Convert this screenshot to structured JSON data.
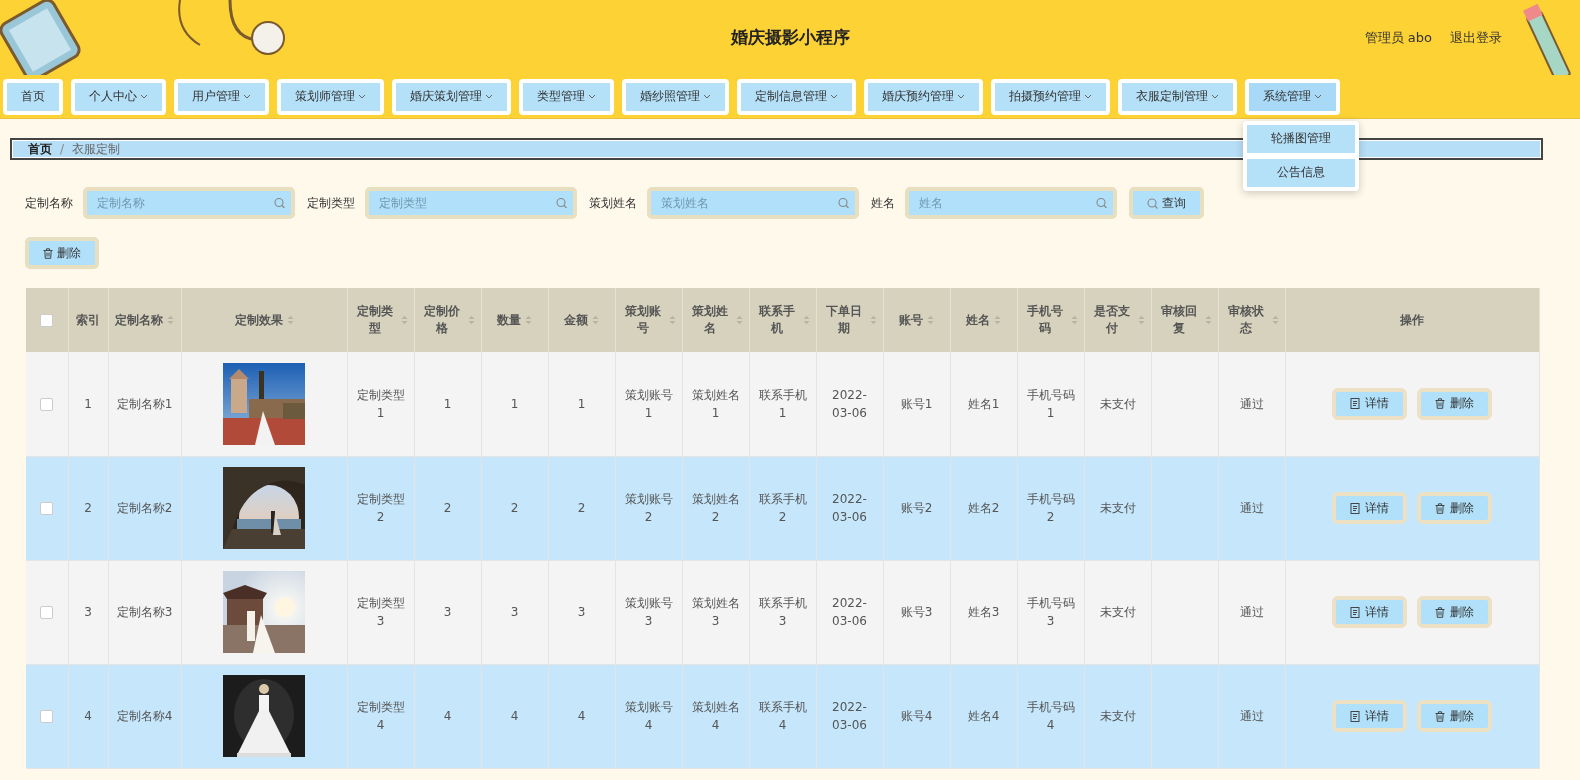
{
  "header": {
    "title": "婚庆摄影小程序",
    "user": "管理员 abo",
    "logout": "退出登录"
  },
  "nav": [
    {
      "label": "首页",
      "has_menu": false,
      "open": false
    },
    {
      "label": "个人中心",
      "has_menu": true,
      "open": false
    },
    {
      "label": "用户管理",
      "has_menu": true,
      "open": false
    },
    {
      "label": "策划师管理",
      "has_menu": true,
      "open": false
    },
    {
      "label": "婚庆策划管理",
      "has_menu": true,
      "open": false
    },
    {
      "label": "类型管理",
      "has_menu": true,
      "open": false
    },
    {
      "label": "婚纱照管理",
      "has_menu": true,
      "open": false
    },
    {
      "label": "定制信息管理",
      "has_menu": true,
      "open": false
    },
    {
      "label": "婚庆预约管理",
      "has_menu": true,
      "open": false
    },
    {
      "label": "拍摄预约管理",
      "has_menu": true,
      "open": false
    },
    {
      "label": "衣服定制管理",
      "has_menu": true,
      "open": false
    },
    {
      "label": "系统管理",
      "has_menu": true,
      "open": true,
      "menu": [
        "轮播图管理",
        "公告信息"
      ]
    }
  ],
  "breadcrumb": {
    "items": [
      "首页",
      "衣服定制"
    ],
    "separator": "/"
  },
  "search": {
    "fields": [
      {
        "label": "定制名称",
        "placeholder": "定制名称"
      },
      {
        "label": "定制类型",
        "placeholder": "定制类型"
      },
      {
        "label": "策划姓名",
        "placeholder": "策划姓名"
      },
      {
        "label": "姓名",
        "placeholder": "姓名"
      }
    ],
    "button": "查询"
  },
  "delete_button": "删除",
  "table": {
    "select_all": {
      "checked": false
    },
    "columns": [
      {
        "label": "索引",
        "sortable": false
      },
      {
        "label": "定制名称",
        "sortable": true
      },
      {
        "label": "定制效果",
        "sortable": true
      },
      {
        "label": "定制类型",
        "sortable": true
      },
      {
        "label": "定制价格",
        "sortable": true
      },
      {
        "label": "数量",
        "sortable": true
      },
      {
        "label": "金额",
        "sortable": true
      },
      {
        "label": "策划账号",
        "sortable": true
      },
      {
        "label": "策划姓名",
        "sortable": true
      },
      {
        "label": "联系手机",
        "sortable": true
      },
      {
        "label": "下单日期",
        "sortable": true
      },
      {
        "label": "账号",
        "sortable": true
      },
      {
        "label": "姓名",
        "sortable": true
      },
      {
        "label": "手机号码",
        "sortable": true
      },
      {
        "label": "是否支付",
        "sortable": true
      },
      {
        "label": "审核回复",
        "sortable": true
      },
      {
        "label": "审核状态",
        "sortable": true
      },
      {
        "label": "操作",
        "sortable": false
      }
    ],
    "rows": [
      {
        "checked": false,
        "cells": [
          "1",
          "定制名称1",
          {
            "kind": "picture"
          },
          "定制类型1",
          "1",
          "1",
          "1",
          "策划账号1",
          "策划姓名1",
          "联系手机1",
          "2022-03-06",
          "账号1",
          "姓名1",
          "手机号码1",
          "未支付",
          null,
          "通过",
          {
            "kind": "actions",
            "buttons": [
              "详情",
              "删除"
            ]
          }
        ]
      },
      {
        "checked": false,
        "cells": [
          "2",
          "定制名称2",
          {
            "kind": "picture"
          },
          "定制类型2",
          "2",
          "2",
          "2",
          "策划账号2",
          "策划姓名2",
          "联系手机2",
          "2022-03-06",
          "账号2",
          "姓名2",
          "手机号码2",
          "未支付",
          null,
          "通过",
          {
            "kind": "actions",
            "buttons": [
              "详情",
              "删除"
            ]
          }
        ]
      },
      {
        "checked": false,
        "cells": [
          "3",
          "定制名称3",
          {
            "kind": "picture"
          },
          "定制类型3",
          "3",
          "3",
          "3",
          "策划账号3",
          "策划姓名3",
          "联系手机3",
          "2022-03-06",
          "账号3",
          "姓名3",
          "手机号码3",
          "未支付",
          null,
          "通过",
          {
            "kind": "actions",
            "buttons": [
              "详情",
              "删除"
            ]
          }
        ]
      },
      {
        "checked": false,
        "cells": [
          "4",
          "定制名称4",
          {
            "kind": "picture"
          },
          "定制类型4",
          "4",
          "4",
          "4",
          "策划账号4",
          "策划姓名4",
          "联系手机4",
          "2022-03-06",
          "账号4",
          "姓名4",
          "手机号码4",
          "未支付",
          null,
          "通过",
          {
            "kind": "actions",
            "buttons": [
              "详情",
              "删除"
            ]
          }
        ]
      }
    ]
  }
}
